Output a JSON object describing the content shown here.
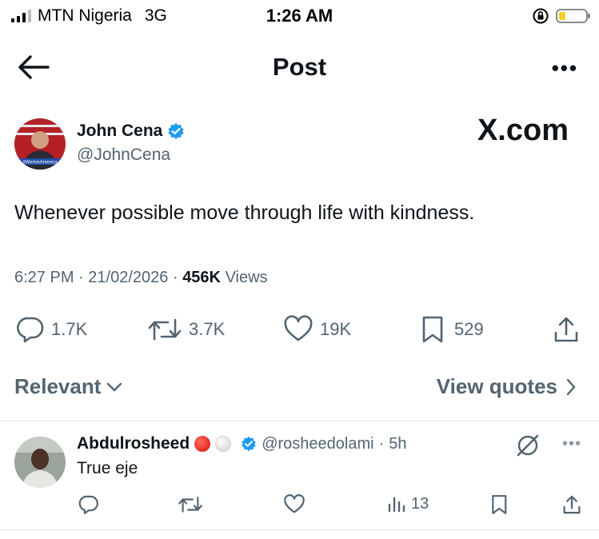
{
  "status_bar": {
    "carrier": "MTN Nigeria",
    "network": "3G",
    "time": "1:26 AM",
    "icons": [
      "signal-bars-icon",
      "orientation-lock-icon",
      "battery-icon"
    ],
    "battery_color": "#f2d021"
  },
  "header": {
    "title": "Post",
    "back_icon": "arrow-left-icon",
    "more_label": "•••"
  },
  "post": {
    "author_name": "John Cena",
    "author_handle": "@JohnCena",
    "verified": true,
    "avatar_caption": "#WeAreAmerica",
    "site_label": "X.com",
    "text": "Whenever possible move through life with kindness.",
    "time": "6:27 PM",
    "date": "21/02/2026",
    "views_count": "456K",
    "views_label": "Views",
    "separator": "·",
    "actions": {
      "replies": "1.7K",
      "reposts": "3.7K",
      "likes": "19K",
      "bookmarks": "529"
    }
  },
  "replies_header": {
    "sort_label": "Relevant",
    "quotes_label": "View quotes"
  },
  "reply": {
    "name": "Abdulrosheed",
    "handle": "@rosheedolami",
    "age": "5h",
    "separator": "·",
    "verified": true,
    "text": "True eje",
    "more_label": "•••",
    "views": "13"
  },
  "colors": {
    "text": "#0f1419",
    "secondary": "#536471",
    "verified": "#1d9bf0",
    "divider": "#e2e6e9"
  }
}
